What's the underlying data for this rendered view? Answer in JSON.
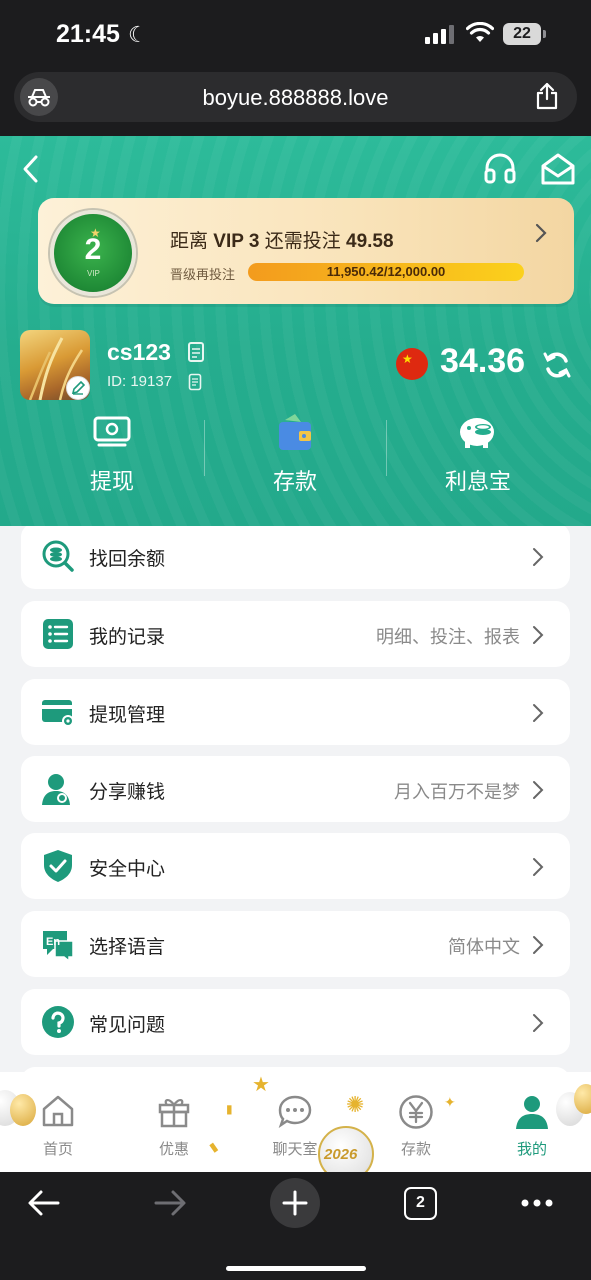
{
  "status_bar": {
    "time": "21:45",
    "battery": "22"
  },
  "browser": {
    "url": "boyue.888888.love",
    "tab_count": "2"
  },
  "vip": {
    "level": "2",
    "prefix": "距离",
    "target": "VIP 3",
    "middle": "还需投注",
    "amount": "49.58",
    "progress_label": "晋级再投注",
    "progress_text": "11,950.42/12,000.00",
    "progress_fraction": 0.9959
  },
  "user": {
    "name": "cs123",
    "id": "ID: 19137",
    "balance": "34.36"
  },
  "actions": [
    {
      "label": "提现",
      "icon": "withdraw-icon"
    },
    {
      "label": "存款",
      "icon": "wallet-icon"
    },
    {
      "label": "利息宝",
      "icon": "piggy-bank-icon"
    }
  ],
  "menu": [
    {
      "label": "找回余额",
      "value": "",
      "icon": "coin-search-icon"
    },
    {
      "label": "我的记录",
      "value": "明细、投注、报表",
      "icon": "records-list-icon"
    },
    {
      "label": "提现管理",
      "value": "",
      "icon": "card-settings-icon"
    },
    {
      "label": "分享赚钱",
      "value": "月入百万不是梦",
      "icon": "share-user-icon"
    },
    {
      "label": "安全中心",
      "value": "",
      "icon": "shield-check-icon"
    },
    {
      "label": "选择语言",
      "value": "简体中文",
      "icon": "language-icon"
    },
    {
      "label": "常见问题",
      "value": "",
      "icon": "question-icon"
    }
  ],
  "tabs": [
    {
      "label": "首页",
      "icon": "home-icon"
    },
    {
      "label": "优惠",
      "icon": "gift-icon"
    },
    {
      "label": "聊天室",
      "icon": "chat-icon"
    },
    {
      "label": "存款",
      "icon": "yen-icon"
    },
    {
      "label": "我的",
      "icon": "profile-icon"
    }
  ],
  "decoration": {
    "ornament_text": "2026"
  },
  "colors": {
    "primary": "#25ad8e",
    "accent": "#1e9a7c",
    "progress": "#f39b1d",
    "flag_red": "#de2910"
  }
}
